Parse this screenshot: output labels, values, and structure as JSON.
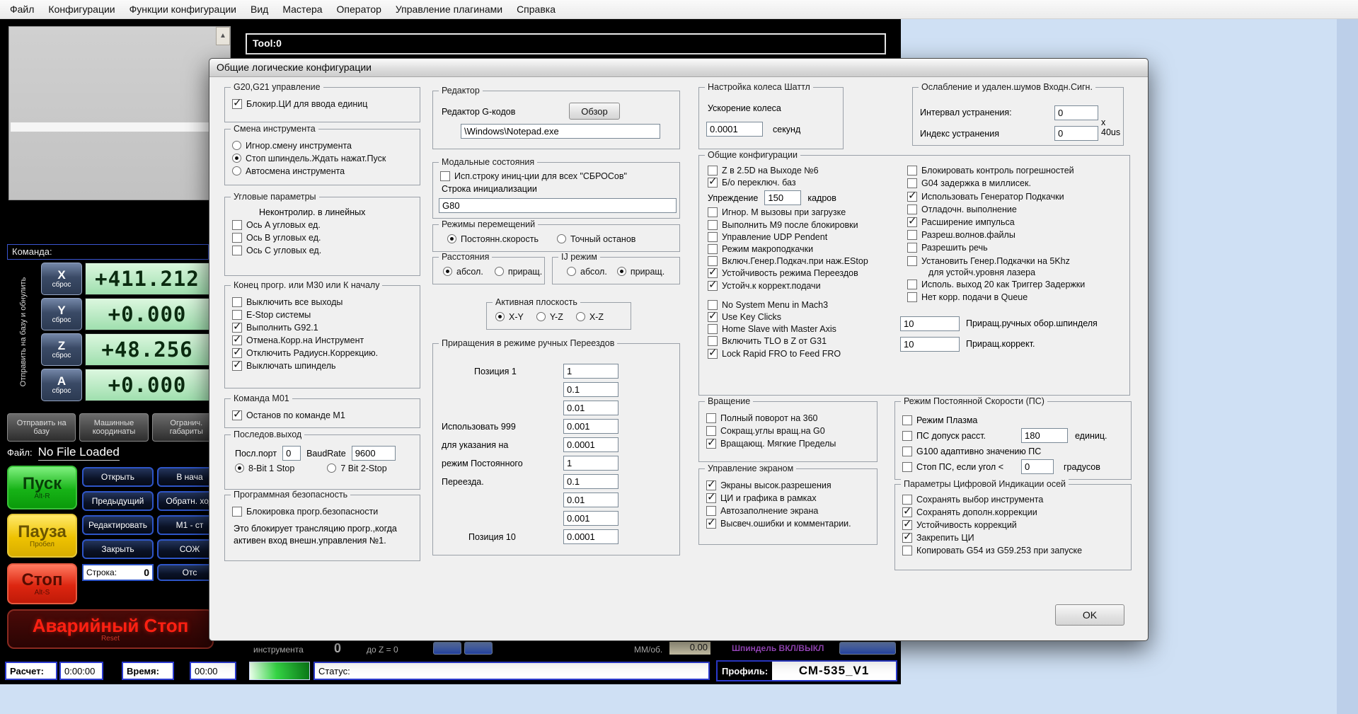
{
  "menu": {
    "items": [
      {
        "label": "Файл"
      },
      {
        "label": "Конфигурации"
      },
      {
        "label": "Функции конфигурации"
      },
      {
        "label": "Вид"
      },
      {
        "label": "Мастера"
      },
      {
        "label": "Оператор"
      },
      {
        "label": "Управление плагинами"
      },
      {
        "label": "Справка"
      }
    ]
  },
  "bg": {
    "tool_label": "Tool:0",
    "command_label": "Команда:",
    "home_strip_label": "Отправить на базу и обнулить",
    "dro": [
      {
        "axis": "X",
        "btn": "сброс",
        "value": "+411.212"
      },
      {
        "axis": "Y",
        "btn": "сброс",
        "value": "+0.000"
      },
      {
        "axis": "Z",
        "btn": "сброс",
        "value": "+48.256"
      },
      {
        "axis": "A",
        "btn": "сброс",
        "value": "+0.000"
      }
    ],
    "ref_buttons": [
      {
        "label": "Отправить на базу"
      },
      {
        "label": "Машинные координаты"
      },
      {
        "label": "Огранич. габариты"
      }
    ],
    "file_label": "Файл:",
    "file_value": "No File Loaded",
    "cycle_start": {
      "label": "Пуск",
      "sub": "Alt-R"
    },
    "pause": {
      "label": "Пауза",
      "sub": "Пробел"
    },
    "stop": {
      "label": "Стоп",
      "sub": "Alt-S"
    },
    "estop": {
      "label": "Аварийный Стоп",
      "sub": "Reset"
    },
    "side_buttons": [
      {
        "label": "Открыть"
      },
      {
        "label": "В нача"
      },
      {
        "label": "Предыдущий"
      },
      {
        "label": "Обратн. ход"
      },
      {
        "label": "Редактировать"
      },
      {
        "label": "М1 - ст"
      },
      {
        "label": "Закрыть"
      },
      {
        "label": "СОЖ"
      }
    ],
    "line_label": "Строка:",
    "line_value": "0",
    "line_btn": "Отс",
    "fragments": {
      "tool_text": "инструмента",
      "tool_num": "0",
      "dz_text": "до Z = 0",
      "mm_label": "ММ/об.",
      "mm_value": "0.00",
      "spindle_text": "Шпиндель ВКЛ/ВЫКЛ"
    },
    "statusbar": {
      "calc_label": "Расчет:",
      "calc_value": "0:00:00",
      "time_label": "Время:",
      "time_value": "00:00",
      "status_label": "Статус:",
      "profile_label": "Профиль:",
      "profile_value": "СМ-535_V1"
    }
  },
  "dialog": {
    "title": "Общие логические конфигурации",
    "ok_label": "OK",
    "g20": {
      "title": "G20,G21 управление",
      "items": [
        {
          "label": "Блокир.ЦИ для ввода единиц",
          "on": true
        }
      ]
    },
    "tool_change": {
      "title": "Смена инструмента",
      "items": [
        {
          "label": "Игнор.смену инструмента",
          "on": false
        },
        {
          "label": "Стоп шпиндель.Ждать нажат.Пуск",
          "on": true
        },
        {
          "label": "Автосмена инструмента",
          "on": false
        }
      ]
    },
    "angular": {
      "title": "Угловые параметры",
      "note": "Неконтролир. в линейных",
      "items": [
        {
          "label": "Ось A угловых ед.",
          "on": false
        },
        {
          "label": "Ось B угловых ед.",
          "on": false
        },
        {
          "label": "Ось C угловых ед.",
          "on": false
        }
      ]
    },
    "pgm_end": {
      "title": "Конец прогр. или M30 или К началу",
      "items": [
        {
          "label": "Выключить все выходы",
          "on": false
        },
        {
          "label": "E-Stop системы",
          "on": false
        },
        {
          "label": "Выполнить G92.1",
          "on": true
        },
        {
          "label": "Отмена.Корр.на Инструмент",
          "on": true
        },
        {
          "label": "Отключить Радиусн.Коррекцию.",
          "on": true
        },
        {
          "label": "Выключать шпиндель",
          "on": true
        }
      ]
    },
    "m01": {
      "title": "Команда M01",
      "items": [
        {
          "label": "Останов по команде M1",
          "on": true
        }
      ]
    },
    "serial": {
      "title": "Последов.выход",
      "port_label": "Посл.порт",
      "port_value": "0",
      "baud_label": "BaudRate",
      "baud_value": "9600",
      "items": [
        {
          "label": "8-Bit 1 Stop",
          "on": true
        },
        {
          "label": "7 Bit 2-Stop",
          "on": false
        }
      ]
    },
    "safety": {
      "title": "Программная безопасность",
      "items": [
        {
          "label": "Блокировка прогр.безопасности",
          "on": false
        }
      ],
      "note1": "Это блокирует трансляцию прогр.,когда",
      "note2": "активен вход внешн.управления №1."
    },
    "editor": {
      "title": "Редактор",
      "label": "Редактор G-кодов",
      "browse_label": "Обзор",
      "path_value": "\\Windows\\Notepad.exe"
    },
    "modal": {
      "title": "Модальные состояния",
      "items": [
        {
          "label": "Исп.строку иниц-ции для всех \"СБРОСов\"",
          "on": false
        }
      ],
      "init_label": "Строка инициализации",
      "init_value": "G80"
    },
    "motion": {
      "title": "Режимы перемещений",
      "items": [
        {
          "label": "Постоянн.скорость",
          "on": true
        },
        {
          "label": "Точный останов",
          "on": false
        }
      ]
    },
    "distance": {
      "title": "Расстояния",
      "items": [
        {
          "label": "абсол.",
          "on": true
        },
        {
          "label": "приращ.",
          "on": false
        }
      ]
    },
    "ij_mode": {
      "title": "IJ режим",
      "items": [
        {
          "label": "абсол.",
          "on": false
        },
        {
          "label": "приращ.",
          "on": true
        }
      ]
    },
    "plane": {
      "title": "Активная плоскость",
      "items": [
        {
          "label": "X-Y",
          "on": true
        },
        {
          "label": "Y-Z",
          "on": false
        },
        {
          "label": "X-Z",
          "on": false
        }
      ]
    },
    "jog": {
      "title": "Приращения в режиме ручных Переездов",
      "pos1_label": "Позиция 1",
      "pos10_label": "Позиция 10",
      "note_lines": [
        {
          "t": "Использовать 999"
        },
        {
          "t": "для указания на"
        },
        {
          "t": "режим Постоянного"
        },
        {
          "t": "Переезда."
        }
      ],
      "values": [
        {
          "v": "1"
        },
        {
          "v": "0.1"
        },
        {
          "v": "0.01"
        },
        {
          "v": "0.001"
        },
        {
          "v": "0.0001"
        },
        {
          "v": "1"
        },
        {
          "v": "0.1"
        },
        {
          "v": "0.01"
        },
        {
          "v": "0.001"
        },
        {
          "v": "0.0001"
        }
      ]
    },
    "shuttle": {
      "title": "Настройка колеса Шаттл",
      "label": "Ускорение колеса",
      "value": "0.0001",
      "unit": "секунд"
    },
    "general": {
      "title": "Общие конфигурации",
      "left_a": [
        {
          "label": "Z в 2.5D на Выходе №6",
          "on": false
        },
        {
          "label": "Б/о переключ. баз",
          "on": true
        }
      ],
      "lookahead_label": "Упреждение",
      "lookahead_value": "150",
      "lookahead_unit": "кадров",
      "left_b": [
        {
          "label": "Игнор. M вызовы при загрузке",
          "on": false
        },
        {
          "label": "Выполнить M9 после блокировки",
          "on": false
        },
        {
          "label": "Управление UDP Pendent",
          "on": false
        },
        {
          "label": "Режим макроподкачки",
          "on": false
        },
        {
          "label": "Включ.Генер.Подкач.при наж.EStop",
          "on": false
        },
        {
          "label": "Устойчивость режима Переездов",
          "on": true
        },
        {
          "label": "Устойч.к коррект.подачи",
          "on": true
        }
      ],
      "left_c": [
        {
          "label": "No System Menu in Mach3",
          "on": false
        },
        {
          "label": "Use Key Clicks",
          "on": true
        },
        {
          "label": "Home Slave with Master Axis",
          "on": false
        },
        {
          "label": "Включить TLO в Z от G31",
          "on": false
        },
        {
          "label": "Lock Rapid FRO to Feed FRO",
          "on": true
        }
      ],
      "right": [
        {
          "label": "Блокировать контроль погрешностей",
          "on": false
        },
        {
          "label": "G04 задержка в миллисек.",
          "on": false
        },
        {
          "label": "Использовать Генератор Подкачки",
          "on": true
        },
        {
          "label": "Отладочн. выполнение",
          "on": false
        },
        {
          "label": "Расширение импульса",
          "on": true
        },
        {
          "label": "Разреш.волнов.файлы",
          "on": false
        },
        {
          "label": "Разрешить речь",
          "on": false
        },
        {
          "label": "Установить Генер.Подкачки на 5Khz",
          "on": false,
          "label2": "для устойч.уровня лазера"
        },
        {
          "label": "Исполь. выход 20 как Триггер Задержки",
          "on": false
        },
        {
          "label": "Нет корр. подачи в Queue",
          "on": false
        }
      ],
      "spindle_inc_value": "10",
      "spindle_inc_label": "Приращ.ручных обор.шпинделя",
      "corr_inc_value": "10",
      "corr_inc_label": "Приращ.коррект."
    },
    "rotation": {
      "title": "Вращение",
      "items": [
        {
          "label": "Полный поворот на 360",
          "on": false
        },
        {
          "label": "Сокращ.углы вращ.на G0",
          "on": false
        },
        {
          "label": "Вращающ. Мягкие Пределы",
          "on": true
        }
      ]
    },
    "screen": {
      "title": "Управление экраном",
      "items": [
        {
          "label": "Экраны высок.разрешения",
          "on": true
        },
        {
          "label": "ЦИ и графика в рамках",
          "on": true
        },
        {
          "label": "Автозаполнение экрана",
          "on": false
        },
        {
          "label": "Высвеч.ошибки и комментарии.",
          "on": true
        }
      ]
    },
    "debounce": {
      "title": "Ослабление и удален.шумов Входн.Сигн.",
      "interval_label": "Интервал устранения:",
      "interval_value": "0",
      "index_label": "Индекс устранения",
      "index_value": "0",
      "unit": "x 40us"
    },
    "cv": {
      "title": "Режим Постоянной Скорости (ПС)",
      "plasma": {
        "label": "Режим Плазма",
        "on": false
      },
      "tolerance": {
        "label": "ПС допуск расст.",
        "on": false,
        "value": "180",
        "unit": "единиц."
      },
      "g100": {
        "label": "G100 адаптивно значению ПС",
        "on": false
      },
      "stop_angle": {
        "label": "Стоп ПС, если угол <",
        "on": false,
        "value": "0",
        "unit": "градусов"
      }
    },
    "axis_dro": {
      "title": "Параметры Цифровой Индикации осей",
      "items": [
        {
          "label": "Сохранять выбор инструмента",
          "on": false
        },
        {
          "label": "Сохранять дополн.коррекции",
          "on": true
        },
        {
          "label": "Устойчивость коррекций",
          "on": true
        },
        {
          "label": "Закрепить ЦИ",
          "on": true
        },
        {
          "label": "Копировать G54 из G59.253 при запуске",
          "on": false
        }
      ]
    }
  }
}
